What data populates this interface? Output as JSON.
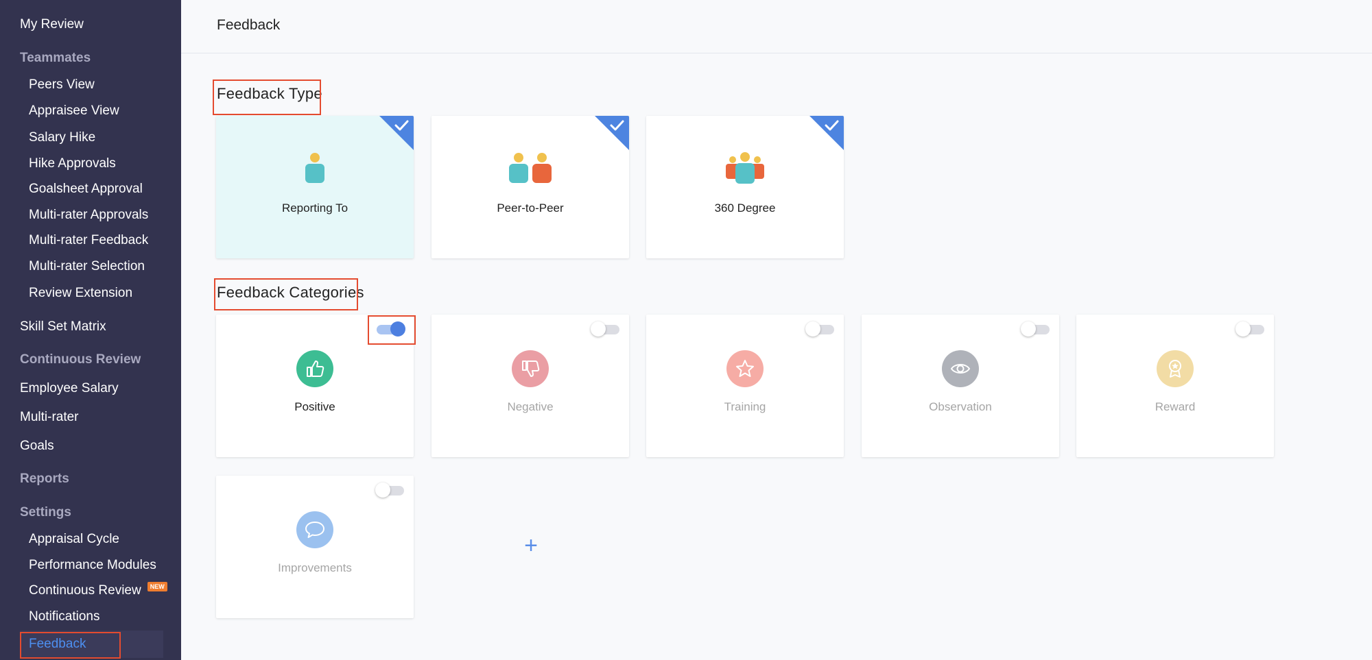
{
  "sidebar": {
    "items": [
      {
        "label": "My Review",
        "kind": "top"
      },
      {
        "label": "Teammates",
        "kind": "section"
      },
      {
        "label": "Peers View",
        "kind": "sub"
      },
      {
        "label": "Appraisee View",
        "kind": "sub"
      },
      {
        "label": "Salary Hike",
        "kind": "sub"
      },
      {
        "label": "Hike Approvals",
        "kind": "sub"
      },
      {
        "label": "Goalsheet Approval",
        "kind": "sub"
      },
      {
        "label": "Multi-rater Approvals",
        "kind": "sub"
      },
      {
        "label": "Multi-rater Feedback",
        "kind": "sub"
      },
      {
        "label": "Multi-rater Selection",
        "kind": "sub"
      },
      {
        "label": "Review Extension",
        "kind": "sub"
      },
      {
        "label": "Skill Set Matrix",
        "kind": "top"
      },
      {
        "label": "Continuous Review",
        "kind": "section"
      },
      {
        "label": "Employee Salary",
        "kind": "top"
      },
      {
        "label": "Multi-rater",
        "kind": "top"
      },
      {
        "label": "Goals",
        "kind": "top"
      },
      {
        "label": "Reports",
        "kind": "section"
      },
      {
        "label": "Settings",
        "kind": "section"
      },
      {
        "label": "Appraisal Cycle",
        "kind": "sub"
      },
      {
        "label": "Performance Modules",
        "kind": "sub"
      },
      {
        "label": "Continuous Review",
        "kind": "sub",
        "badge": "NEW"
      },
      {
        "label": "Notifications",
        "kind": "sub"
      },
      {
        "label": "Feedback",
        "kind": "sub",
        "active": true
      }
    ]
  },
  "header": {
    "title": "Feedback"
  },
  "feedback_type": {
    "title": "Feedback Type",
    "cards": [
      {
        "label": "Reporting To",
        "icon": "single-person-icon",
        "checked": true
      },
      {
        "label": "Peer-to-Peer",
        "icon": "two-people-icon",
        "checked": true
      },
      {
        "label": "360 Degree",
        "icon": "group-people-icon",
        "checked": true
      }
    ]
  },
  "feedback_categories": {
    "title": "Feedback Categories",
    "cards": [
      {
        "label": "Positive",
        "icon": "thumbs-up-icon",
        "color": "#3dbd93",
        "enabled": true
      },
      {
        "label": "Negative",
        "icon": "thumbs-down-icon",
        "color": "#d9505b",
        "enabled": false
      },
      {
        "label": "Training",
        "icon": "star-icon",
        "color": "#ef6a5d",
        "enabled": false
      },
      {
        "label": "Observation",
        "icon": "eye-icon",
        "color": "#6f7580",
        "enabled": false
      },
      {
        "label": "Reward",
        "icon": "award-icon",
        "color": "#e8c15c",
        "enabled": false
      },
      {
        "label": "Improvements",
        "icon": "speech-bubble-icon",
        "color": "#4a8fe2",
        "enabled": false
      }
    ],
    "add_label": "+"
  },
  "colors": {
    "accent": "#4d8ff0",
    "sidebar_bg": "#33334f",
    "highlight": "#e44b2f"
  }
}
